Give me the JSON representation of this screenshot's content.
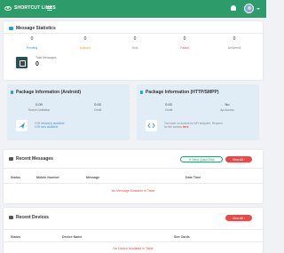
{
  "header": {
    "brand": "SHORTCUT LINKS",
    "accent": "#2e9b6b"
  },
  "message_statistics": {
    "title": "Message Statistics",
    "stats": [
      {
        "value": "0",
        "label": "Pending",
        "color": "#2e9bd6"
      },
      {
        "value": "0",
        "label": "Queued",
        "color": "#f09a2a"
      },
      {
        "value": "0",
        "label": "Sent",
        "color": "#888888"
      },
      {
        "value": "0",
        "label": "Failed",
        "color": "#e54b4b"
      },
      {
        "value": "0",
        "label": "Delivered",
        "color": "#888888"
      }
    ],
    "total_label": "Total Messages",
    "total_value": "0"
  },
  "package_android": {
    "title": "Package Information (Android)",
    "stats": [
      {
        "value": "0.00",
        "label": "Device Limitation"
      },
      {
        "value": "0.00",
        "label": "Credit"
      }
    ],
    "note_line1": "0.00 device(s) available",
    "note_line2": "0.00 sms available"
  },
  "package_http": {
    "title": "Package Information (HTTP/SMPP)",
    "stats": [
      {
        "value": "0.00",
        "label": "Credit"
      },
      {
        "value": "No",
        "label": "Api Access"
      }
    ],
    "note_line1": "You have no access for API endpoint. Request",
    "note_line2": "for the access",
    "note_link": "here"
  },
  "recent_messages": {
    "title": "Recent Messages",
    "send_button": "Send Quick Sms",
    "view_all": "View All",
    "columns": [
      "Status",
      "Mobile Number",
      "Message",
      "Date Time"
    ],
    "empty_text": "No Message Available in Table"
  },
  "recent_devices": {
    "title": "Recent Devices",
    "view_all": "View All",
    "columns": [
      "Status",
      "Device Name",
      "Sim Cards"
    ],
    "empty_text": "No Device Available in Table"
  }
}
